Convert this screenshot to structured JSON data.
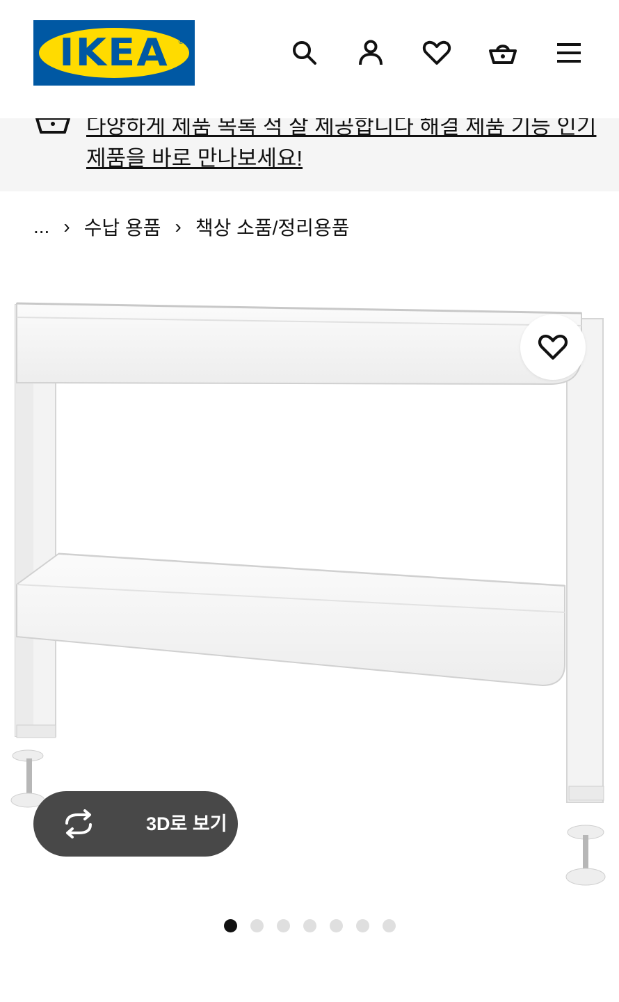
{
  "header": {
    "logo_text": "IKEA",
    "logo_reg": "®",
    "icons": [
      "search-icon",
      "account-icon",
      "heart-icon",
      "basket-icon",
      "menu-icon"
    ]
  },
  "banner": {
    "line1": "다양하게 제품 목록 적 잘 제공합니다 해결 제품 기능 인기",
    "line2": "제품을 바로 만나보세요!"
  },
  "breadcrumb": {
    "ellipsis": "...",
    "items": [
      "수납 용품",
      "책상 소품/정리용품"
    ]
  },
  "product": {
    "view3d_label": "3D로 보기"
  },
  "gallery": {
    "dot_count": 7,
    "active_index": 0
  },
  "colors": {
    "ikea_blue": "#0058a3",
    "ikea_yellow": "#ffdb00",
    "banner_bg": "#f5f5f5",
    "button_dark": "#484848"
  }
}
